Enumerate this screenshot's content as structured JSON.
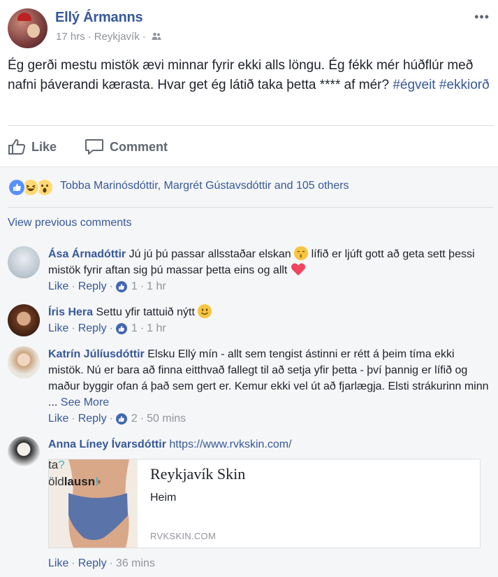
{
  "post": {
    "author": "Ellý Ármanns",
    "time": "17 hrs",
    "location": "Reykjavík",
    "text": "Ég gerði mestu mistök ævi minnar fyrir ekki alls löngu. Ég fékk mér húðflúr með nafni þáverandi kærasta. Hvar get ég látið taka þetta **** af mér? ",
    "hashtags": [
      "#égveit",
      "#ekkiorð"
    ],
    "more_icon": "more-icon"
  },
  "actions": {
    "like": "Like",
    "comment": "Comment"
  },
  "reactions": {
    "icons": [
      "like-reaction-icon",
      "haha-reaction-icon",
      "wow-reaction-icon"
    ],
    "text": "Tobba Marinósdóttir, Margrét Gústavsdóttir and 105 others"
  },
  "view_previous": "View previous comments",
  "comments": [
    {
      "name": "Ása Árnadóttir",
      "text_a": "Jú jú þú passar allsstaðar elskan",
      "text_b": "lífið er ljúft gott að geta sett þessi mistök fyrir aftan sig þú massar þetta eins og allt",
      "like": "Like",
      "reply": "Reply",
      "likes": "1",
      "time": "1 hr"
    },
    {
      "name": "Íris Hera",
      "text": "Settu yfir tattuið nýtt",
      "like": "Like",
      "reply": "Reply",
      "likes": "1",
      "time": "1 hr"
    },
    {
      "name": "Katrín Júlíusdóttir",
      "text": "Elsku Ellý mín - allt sem tengist ástinni er rétt á þeim tíma ekki mistök. Nú er bara að finna eitthvað fallegt til að setja yfir þetta - því þannig er lífið og maður byggir ofan á það sem gert er. Kemur ekki vel út að fjarlægja. Elsti strákurinn minn ...",
      "see_more": "See More",
      "like": "Like",
      "reply": "Reply",
      "likes": "2",
      "time": "50 mins"
    },
    {
      "name": "Anna Líney Ívarsdóttir",
      "link": "https://www.rvkskin.com/",
      "like": "Like",
      "reply": "Reply",
      "time": "36 mins"
    }
  ],
  "link_card": {
    "image_text_1": "ta",
    "image_text_1b": "?",
    "image_text_2a": "öld",
    "image_text_2b": "lausn",
    "image_text_2c": "!",
    "title": "Reykjavík Skin",
    "subtitle": "Heim",
    "domain": "RVKSKIN.COM"
  },
  "colors": {
    "link": "#365899",
    "meta": "#90949c",
    "like_blue": "#4267b2",
    "bg": "#f5f6f7"
  }
}
